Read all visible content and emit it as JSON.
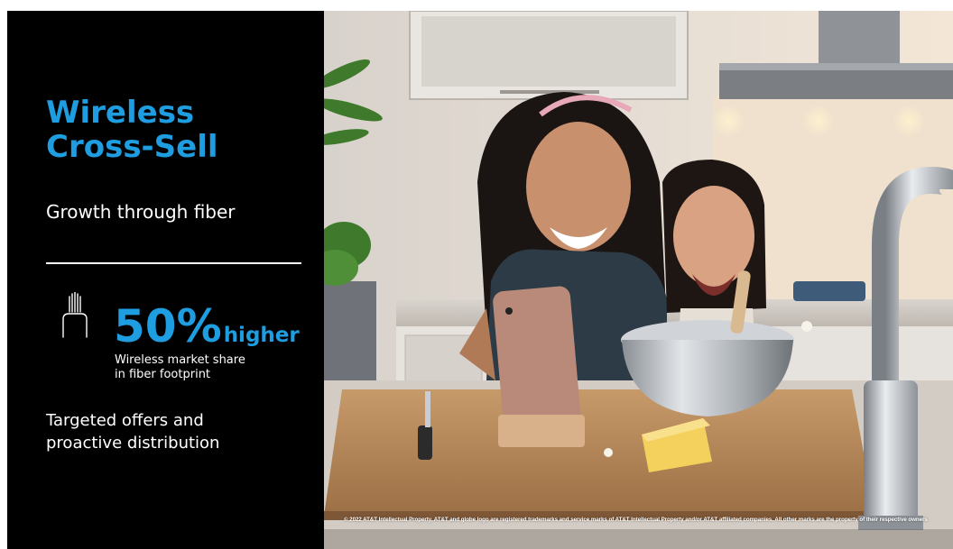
{
  "title_lines": [
    "Wireless",
    "Cross-Sell"
  ],
  "subtitle": "Growth through fiber",
  "stat": {
    "number": "50%",
    "suffix": "higher",
    "caption_lines": [
      "Wireless market share",
      "in fiber footprint"
    ],
    "icon": "fiber-icon"
  },
  "offers_lines": [
    "Targeted offers and",
    "proactive distribution"
  ],
  "legal": "© 2022 AT&T Intellectual Property. AT&T and globe logo are registered trademarks and service marks of AT&T Intellectual Property and/or AT&T affiliated companies. All other marks are the property of their respective owners",
  "photo": {
    "subject": "Mother and daughter laughing at a smartphone video call in a kitchen"
  },
  "colors": {
    "accent_blue": "#1e9de0",
    "panel_black": "#000000",
    "text_white": "#ffffff"
  }
}
